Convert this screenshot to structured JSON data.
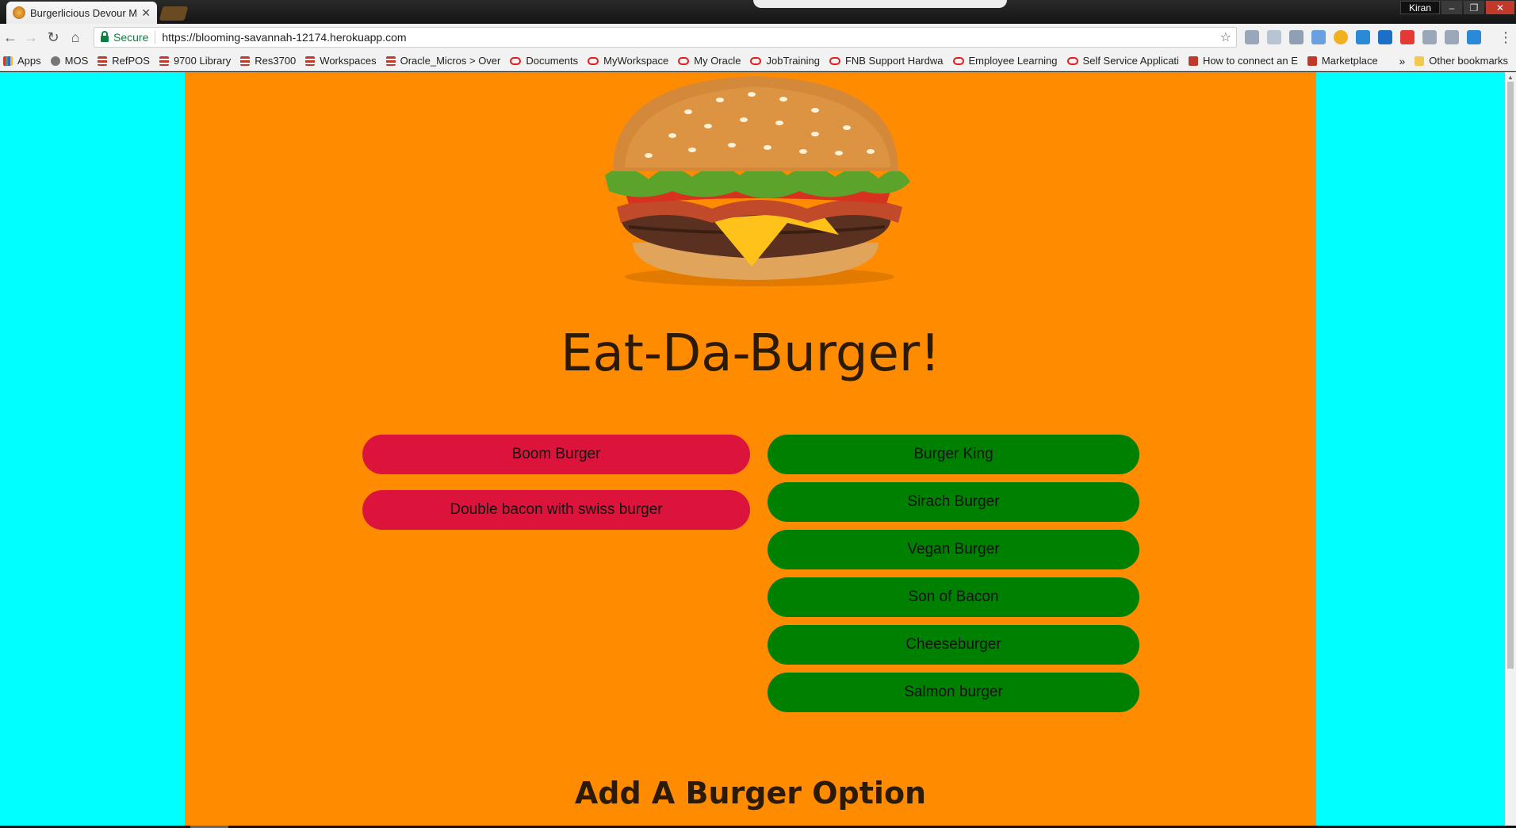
{
  "browser": {
    "tab_title": "Burgerlicious Devour Me",
    "tab_close": "✕",
    "user": "Kiran",
    "secure_label": "Secure",
    "url": "https://blooming-savannah-12174.herokuapp.com",
    "bookmarks": [
      {
        "label": "Apps",
        "icon": "apps"
      },
      {
        "label": "MOS",
        "icon": "globe"
      },
      {
        "label": "RefPOS",
        "icon": "stack"
      },
      {
        "label": "9700 Library",
        "icon": "stack"
      },
      {
        "label": "Res3700",
        "icon": "stack"
      },
      {
        "label": "Workspaces",
        "icon": "stack"
      },
      {
        "label": "Oracle_Micros > Over",
        "icon": "stack"
      },
      {
        "label": "Documents",
        "icon": "oracle"
      },
      {
        "label": "MyWorkspace",
        "icon": "oracle"
      },
      {
        "label": "My Oracle",
        "icon": "oracle"
      },
      {
        "label": "JobTraining",
        "icon": "oracle"
      },
      {
        "label": "FNB Support Hardwa",
        "icon": "oracle"
      },
      {
        "label": "Employee Learning",
        "icon": "oracle"
      },
      {
        "label": "Self Service Applicati",
        "icon": "oracle"
      },
      {
        "label": "How to connect an E",
        "icon": "mag"
      },
      {
        "label": "Marketplace",
        "icon": "mag"
      }
    ],
    "bookmarks_more": "»",
    "other_bookmarks": "Other bookmarks"
  },
  "page": {
    "title": "Eat-Da-Burger!",
    "devoured_burgers": [
      "Boom Burger",
      "Double bacon with swiss burger"
    ],
    "available_burgers": [
      "Burger King",
      "Sirach Burger",
      "Vegan Burger",
      "Son of Bacon",
      "Cheeseburger",
      "Salmon burger"
    ],
    "add_section_title": "Add A Burger Option",
    "colors": {
      "background": "#00ffff",
      "panel": "#ff8c00",
      "devoured": "#dc143c",
      "available": "#008000"
    }
  }
}
